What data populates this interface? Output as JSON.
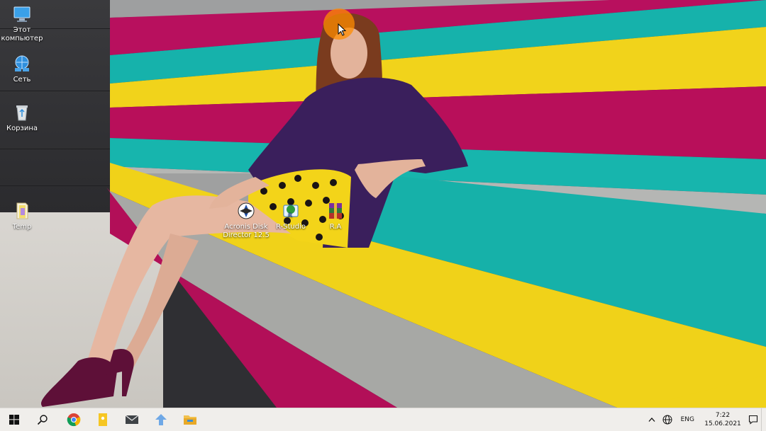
{
  "desktop": {
    "icons": [
      {
        "label": "Этот\nкомпьютер",
        "icon": "computer-icon"
      },
      {
        "label": "Сеть",
        "icon": "network-icon"
      },
      {
        "label": "Корзина",
        "icon": "recycle-bin-icon"
      },
      {
        "label": "Temp",
        "icon": "folder-icon"
      },
      {
        "label": "Acronis Disk\nDirector 12.5",
        "icon": "acronis-icon"
      },
      {
        "label": "R-Studio",
        "icon": "rstudio-icon"
      },
      {
        "label": "R.A",
        "icon": "winrar-icon"
      }
    ]
  },
  "taskbar": {
    "lang": "ENG",
    "time": "7:22",
    "date": "15.06.2021"
  },
  "colors": {
    "magenta": "#b8105e",
    "teal": "#19b7b0",
    "yellow": "#f0d21a",
    "grey": "#a8a9a6",
    "taskbar": "#f0eeeb"
  }
}
